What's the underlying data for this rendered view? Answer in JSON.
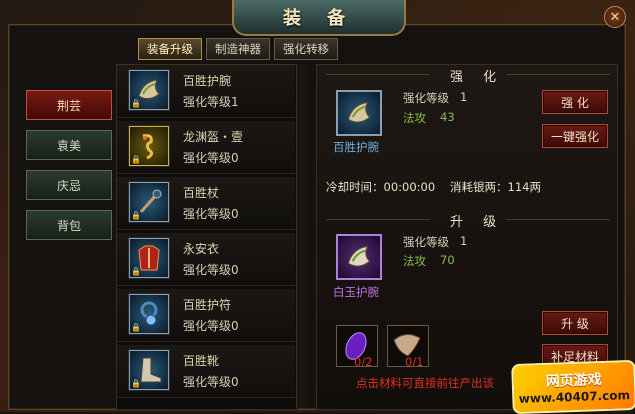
{
  "window": {
    "title": "装 备",
    "close_label": "✕"
  },
  "tabs": [
    {
      "label": "装备升级",
      "active": true
    },
    {
      "label": "制造神器",
      "active": false
    },
    {
      "label": "强化转移",
      "active": false
    }
  ],
  "categories": [
    {
      "label": "荆芸",
      "active": true
    },
    {
      "label": "袁美",
      "active": false
    },
    {
      "label": "庆忌",
      "active": false
    },
    {
      "label": "背包",
      "active": false
    }
  ],
  "items": [
    {
      "name": "百胜护腕",
      "level": "强化等级1",
      "icon": "bracer-icon"
    },
    {
      "name": "龙渊盔・壹",
      "level": "强化等级0",
      "icon": "dragon-helmet-icon"
    },
    {
      "name": "百胜杖",
      "level": "强化等级0",
      "icon": "staff-icon"
    },
    {
      "name": "永安衣",
      "level": "强化等级0",
      "icon": "armor-icon"
    },
    {
      "name": "百胜护符",
      "level": "强化等级0",
      "icon": "amulet-icon"
    },
    {
      "name": "百胜靴",
      "level": "强化等级0",
      "icon": "boots-icon"
    }
  ],
  "strengthen": {
    "title": "强 化",
    "item_name": "百胜护腕",
    "level_label": "强化等级",
    "level_value": "1",
    "stat_label": "法攻",
    "stat_value": "43",
    "button_strengthen": "强 化",
    "button_one_click": "一键强化",
    "cooldown": "冷却时间：00:00:00",
    "cost": "消耗银两：114两"
  },
  "upgrade": {
    "title": "升 级",
    "item_name": "白玉护腕",
    "level_label": "强化等级",
    "level_value": "1",
    "stat_label": "法攻",
    "stat_value": "70",
    "button_upgrade": "升 级",
    "button_materials": "补足材料",
    "materials": [
      {
        "count": "0/2",
        "icon": "purple-gem-icon"
      },
      {
        "count": "0/1",
        "icon": "beast-hide-icon"
      }
    ],
    "hint": "点击材料可直接前往产出该"
  },
  "watermark": {
    "line1": "网页游戏",
    "line2": "www.40407.com"
  },
  "colors": {
    "accent_red": "#7a1a14",
    "green_text": "#8cbf4a",
    "purple_text": "#c070e0",
    "blue_text": "#70b0e0",
    "hint_red": "#e03020"
  }
}
